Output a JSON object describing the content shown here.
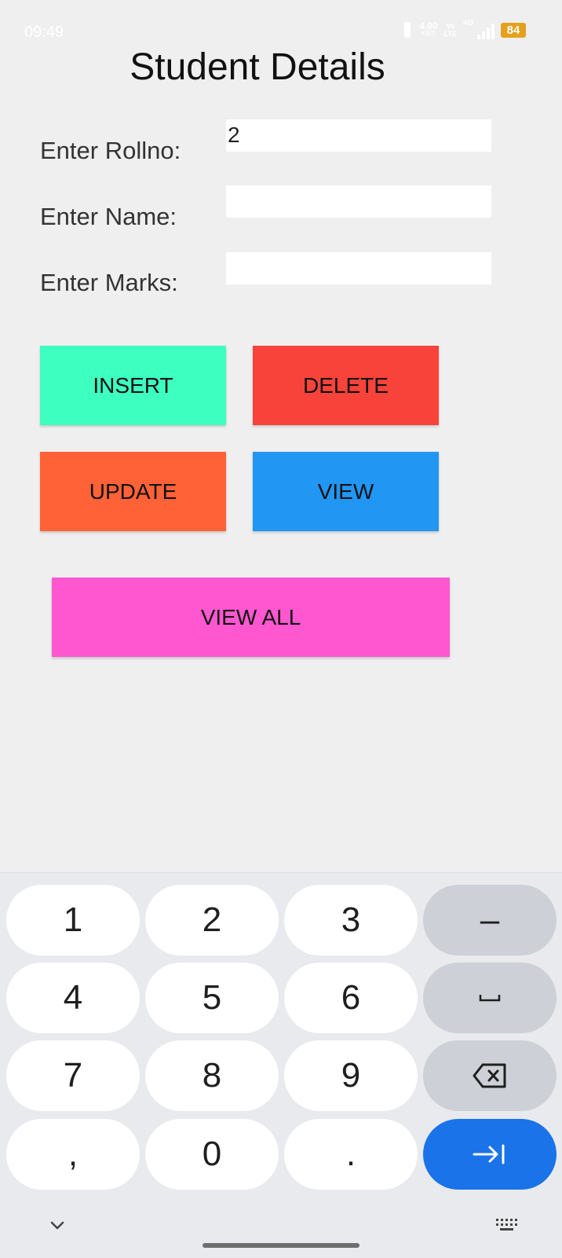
{
  "status_bar": {
    "time": "09:49",
    "net_speed_value": "4.00",
    "net_speed_unit": "KB/S",
    "volte_top": "Vo",
    "volte_bottom": "LTE",
    "network_type": "4G",
    "battery": "84",
    "battery_color": "#e5a11c"
  },
  "page": {
    "title": "Student Details"
  },
  "form": {
    "rollno": {
      "label": "Enter Rollno:",
      "value": "2"
    },
    "name": {
      "label": "Enter Name:",
      "value": ""
    },
    "marks": {
      "label": "Enter Marks:",
      "value": ""
    }
  },
  "buttons": {
    "insert": {
      "label": "INSERT",
      "color": "#3dffc0"
    },
    "delete": {
      "label": "DELETE",
      "color": "#f7433a"
    },
    "update": {
      "label": "UPDATE",
      "color": "#ff6236"
    },
    "view": {
      "label": "VIEW",
      "color": "#2196f3"
    },
    "view_all": {
      "label": "VIEW ALL",
      "color": "#ff57cf"
    }
  },
  "keyboard": {
    "keys": [
      "1",
      "2",
      "3",
      "4",
      "5",
      "6",
      "7",
      "8",
      "9",
      ",",
      "0",
      "."
    ],
    "minus_key": "–",
    "space_icon": "space-bar-icon",
    "backspace_icon": "backspace-icon",
    "next_icon": "tab-next-icon",
    "hide_icon": "chevron-down-icon",
    "switch_icon": "keyboard-icon",
    "accent_color": "#1a73e8"
  }
}
